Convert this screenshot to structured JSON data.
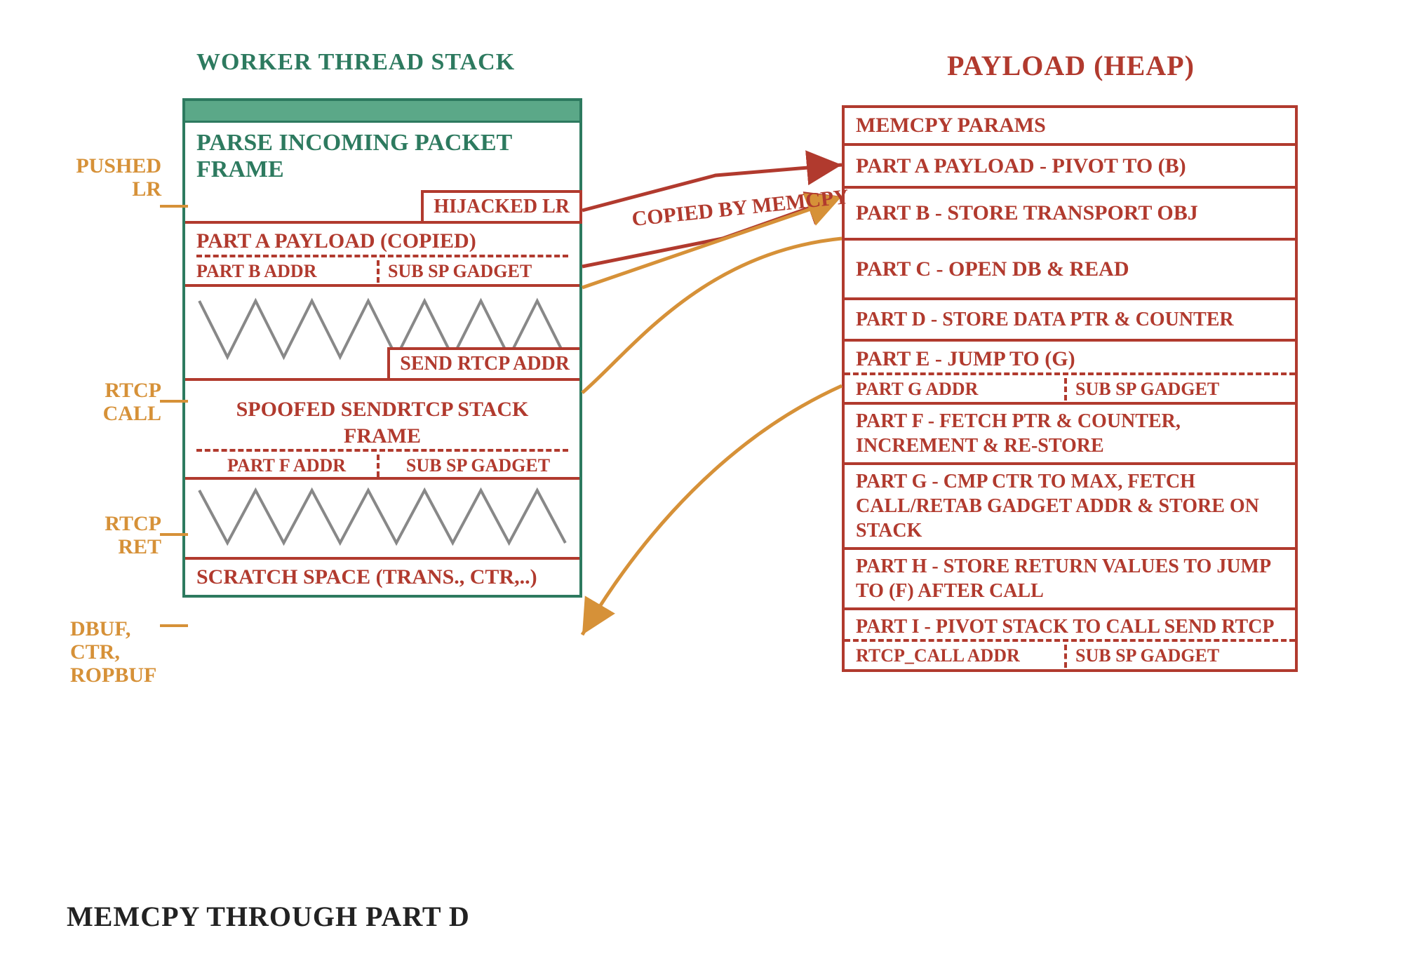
{
  "titles": {
    "stack": "WORKER THREAD STACK",
    "heap": "PAYLOAD (HEAP)"
  },
  "stack": {
    "parse": "PARSE INCOMING PACKET FRAME",
    "hijacked": "HIJACKED LR",
    "partA": "PART A PAYLOAD (COPIED)",
    "partB": "PART B ADDR",
    "subsp": "SUB SP GADGET",
    "sendrtcp": "SEND RTCP ADDR",
    "spoofed": "SPOOFED SENDRTCP STACK FRAME",
    "partF": "PART F ADDR",
    "scratch": "SCRATCH SPACE (TRANS., CTR,..)"
  },
  "heap": {
    "memcpy": "MEMCPY PARAMS",
    "a": "PART A PAYLOAD - PIVOT TO (B)",
    "b": "PART B - STORE TRANSPORT OBJ",
    "c": "PART C - OPEN DB & READ",
    "d": "PART D - STORE DATA PTR & COUNTER",
    "e": "PART E - JUMP TO (G)",
    "gaddr": "PART G ADDR",
    "subsp": "SUB SP GADGET",
    "f": "PART F - FETCH PTR & COUNTER, INCREMENT & RE-STORE",
    "g": "PART G - CMP CTR TO MAX, FETCH CALL/RETAB GADGET ADDR & STORE ON STACK",
    "h": "PART H - STORE RETURN VALUES TO JUMP TO (F) AFTER CALL",
    "i": "PART I - PIVOT STACK TO CALL SEND RTCP",
    "rtcpcall": "RTCP_CALL ADDR"
  },
  "labels": {
    "pushedlr": "PUSHED LR",
    "rtcpcall": "RTCP CALL",
    "rtcpret": "RTCP RET",
    "dbuf": "DBUF, CTR, ROPBUF",
    "copied": "COPIED BY MEMCPY"
  },
  "caption": "MEMCPY THROUGH PART D"
}
